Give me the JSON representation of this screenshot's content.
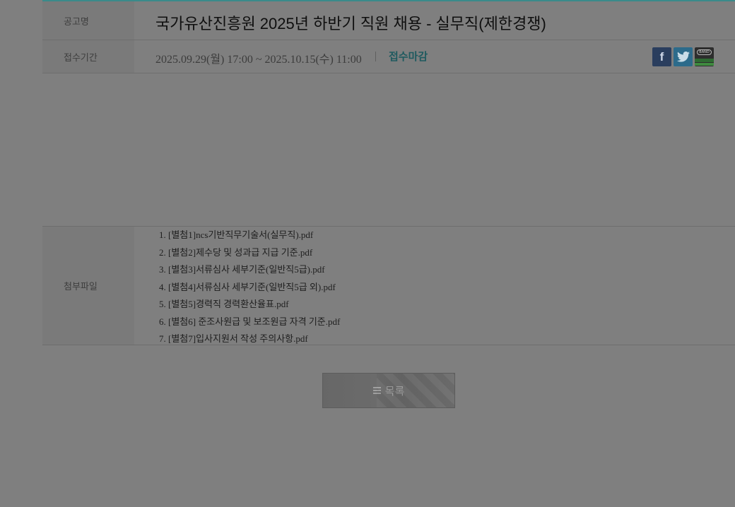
{
  "notice": {
    "title_label": "공고명",
    "title": "국가유산진흥원 2025년 하반기 직원 채용 - 실무직(제한경쟁)",
    "period_label": "접수기간",
    "period": "2025.09.29(월) 17:00 ~ 2025.10.15(수) 11:00",
    "status": "접수마감",
    "attachments_label": "첨부파일",
    "attachments": [
      "1. [별첨1]ncs기반직무기술서(실무직).pdf",
      "2. [별첨2]제수당 및 성과급 지급 기준.pdf",
      "3. [별첨3]서류심사 세부기준(일반직5급).pdf",
      "4. [별첨4]서류심사 세부기준(일반직5급 외).pdf",
      "5. [별첨5]경력직 경력환산율표.pdf",
      "6. [별첨6] 준조사원급 및 보조원급 자격 기준.pdf",
      "7. [별첨7]입사지원서 작성 주의사항.pdf"
    ]
  },
  "share": {
    "facebook": {
      "icon": "facebook-icon",
      "glyph": "f"
    },
    "twitter": {
      "icon": "twitter-icon"
    },
    "band": {
      "icon": "band-icon",
      "text": "BAND"
    }
  },
  "buttons": {
    "list_label": "목록",
    "list_icon": "menu-icon"
  },
  "colors": {
    "overlay": "#7f7f7f",
    "status": "#1f5a5f",
    "accent_line": "#3a8a8a"
  }
}
